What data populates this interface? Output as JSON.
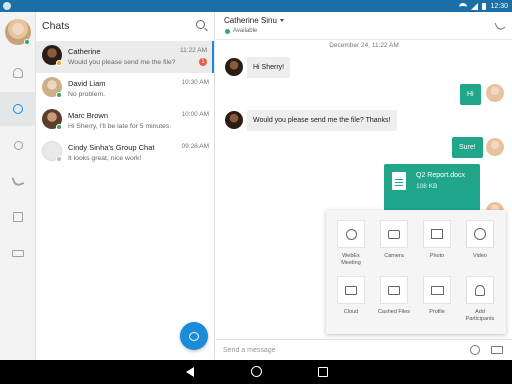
{
  "status_bar": {
    "time": "12:30"
  },
  "sidebar": {
    "items": [
      {
        "name": "contacts"
      },
      {
        "name": "chats"
      },
      {
        "name": "meetings"
      },
      {
        "name": "calls"
      },
      {
        "name": "calendar"
      },
      {
        "name": "voicemail"
      }
    ]
  },
  "chats": {
    "title": "Chats",
    "list": [
      {
        "name": "Catherine",
        "message": "Would you please send me the file?",
        "time": "11:22 AM",
        "unread": "1",
        "presence_color": "#f5a623"
      },
      {
        "name": "David Liam",
        "message": "No problem.",
        "time": "10:30 AM",
        "presence_color": "#3aa757"
      },
      {
        "name": "Marc Brown",
        "message": "Hi Sherry, I'll be late for 5 minutes.",
        "time": "10:00 AM",
        "presence_color": "#3aa757"
      },
      {
        "name": "Cindy Sinha's Group Chat",
        "message": "It looks great, nice work!",
        "time": "09:28 AM",
        "presence_color": "#bbbbbb"
      }
    ]
  },
  "conversation": {
    "contact_name": "Catherine Sinu",
    "status": "Available",
    "date": "December 24, 11:22 AM",
    "messages": [
      {
        "dir": "in",
        "text": "Hi Sherry!"
      },
      {
        "dir": "out",
        "text": "Hi"
      },
      {
        "dir": "in",
        "text": "Would you please send me the file? Thanks!"
      },
      {
        "dir": "out",
        "text": "Sure!"
      }
    ],
    "file": {
      "name": "Q2 Report.docx",
      "size": "108 KB"
    },
    "composer_placeholder": "Send a message"
  },
  "attach_menu": {
    "items": [
      {
        "label": "WebEx Meeting",
        "icon": "webex-icon"
      },
      {
        "label": "Camera",
        "icon": "camera-icon"
      },
      {
        "label": "Photo",
        "icon": "photo-icon"
      },
      {
        "label": "Video",
        "icon": "video-icon"
      },
      {
        "label": "Cloud",
        "icon": "cloud-folder-icon"
      },
      {
        "label": "Cashed Files",
        "icon": "cached-files-icon"
      },
      {
        "label": "Profile",
        "icon": "profile-card-icon"
      },
      {
        "label": "Add Participants",
        "icon": "add-participant-icon"
      }
    ]
  },
  "colors": {
    "accent": "#1a8cd8",
    "bubble_out": "#21a68c",
    "status_bar": "#1a6fa6"
  }
}
